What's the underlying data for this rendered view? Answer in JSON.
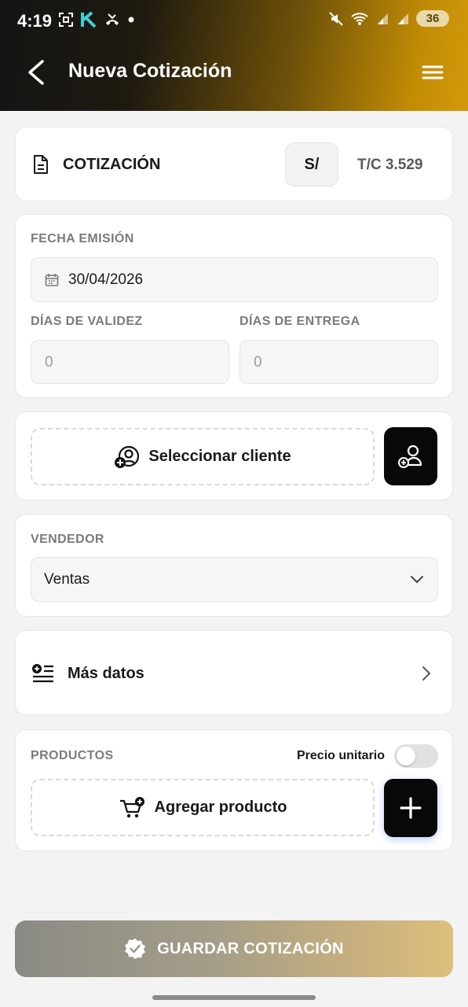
{
  "status_bar": {
    "time": "4:19",
    "battery": "36"
  },
  "header": {
    "title": "Nueva Cotización",
    "gradient_start": "#141414",
    "gradient_end": "#d4990a"
  },
  "doc_card": {
    "doc_type": "COTIZACIÓN",
    "currency": "S/",
    "exchange_rate": "T/C 3.529"
  },
  "dates_card": {
    "fecha_emision_label": "FECHA EMISIÓN",
    "fecha_emision_value": "30/04/2026",
    "dias_validez_label": "DÍAS DE VALIDEZ",
    "dias_validez_placeholder": "0",
    "dias_entrega_label": "DÍAS DE ENTREGA",
    "dias_entrega_placeholder": "0"
  },
  "client_card": {
    "select_label": "Seleccionar cliente"
  },
  "seller_card": {
    "label": "VENDEDOR",
    "selected": "Ventas"
  },
  "more_card": {
    "label": "Más datos"
  },
  "products_card": {
    "label": "PRODUCTOS",
    "toggle_label": "Precio unitario",
    "toggle_on": false,
    "add_label": "Agregar producto"
  },
  "footer": {
    "save_label": "GUARDAR COTIZACIÓN"
  }
}
